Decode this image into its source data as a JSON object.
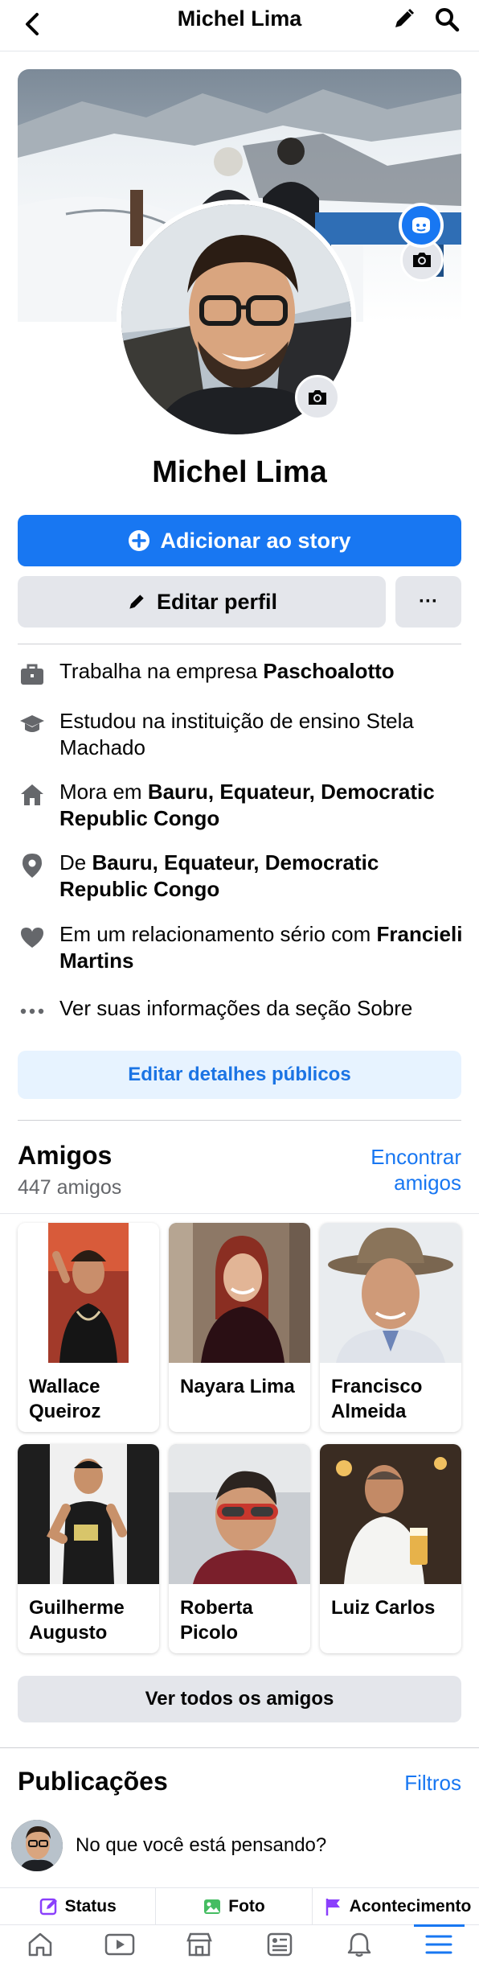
{
  "header": {
    "title": "Michel Lima"
  },
  "profile": {
    "name": "Michel Lima",
    "add_story_label": "Adicionar ao story",
    "edit_profile_label": "Editar perfil",
    "more_label": "···"
  },
  "details": [
    {
      "icon": "briefcase-icon",
      "prefix": "Trabalha na empresa ",
      "bold": "Paschoalotto"
    },
    {
      "icon": "graduation-cap-icon",
      "prefix": "Estudou na instituição de ensino Stela Machado",
      "bold": ""
    },
    {
      "icon": "home-icon",
      "prefix": "Mora em ",
      "bold": "Bauru, Equateur, Democratic Republic Congo"
    },
    {
      "icon": "location-pin-icon",
      "prefix": "De ",
      "bold": "Bauru, Equateur, Democratic Republic Congo"
    },
    {
      "icon": "heart-icon",
      "prefix": "Em um relacionamento sério com ",
      "bold": "Francieli Martins"
    },
    {
      "icon": "more-dots-icon",
      "prefix": "Ver suas informações da seção Sobre",
      "bold": ""
    }
  ],
  "edit_public_label": "Editar detalhes públicos",
  "friends": {
    "title": "Amigos",
    "count": "447 amigos",
    "find_link": "Encontrar amigos",
    "see_all": "Ver todos os amigos",
    "list": [
      {
        "name": "Wallace Queiroz"
      },
      {
        "name": "Nayara Lima"
      },
      {
        "name": "Francisco Almeida"
      },
      {
        "name": "Guilherme Augusto"
      },
      {
        "name": "Roberta Picolo"
      },
      {
        "name": "Luiz Carlos"
      }
    ]
  },
  "posts": {
    "title": "Publicações",
    "filters": "Filtros",
    "composer_placeholder": "No que você está pensando?",
    "actions": {
      "status": "Status",
      "photo": "Foto",
      "event": "Acontecimento"
    }
  },
  "colors": {
    "accent": "#1877f2",
    "light_accent": "#e7f3ff",
    "gray_button": "#e4e6eb"
  }
}
